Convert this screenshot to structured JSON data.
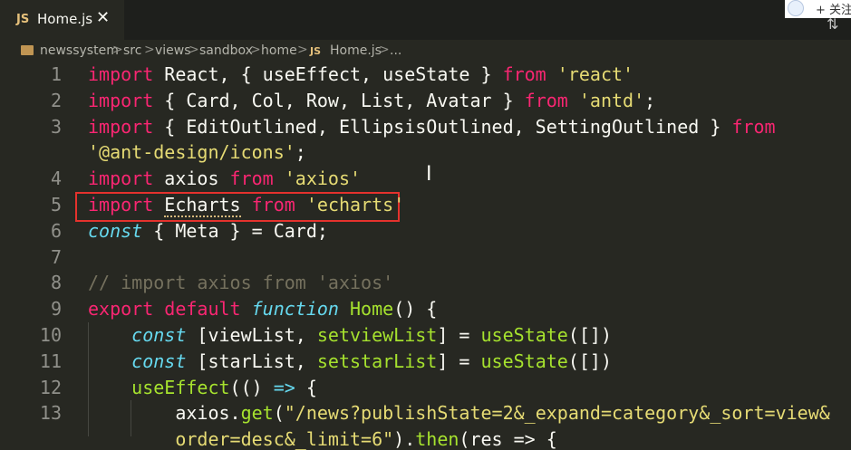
{
  "tab": {
    "badge": "JS",
    "filename": "Home.js",
    "close": "✕"
  },
  "account": {
    "follow_label": "+ 关注"
  },
  "toolbar": {
    "icon": "⇅"
  },
  "breadcrumb": {
    "parts": [
      "newssystem",
      "src",
      "views",
      "sandbox",
      "home"
    ],
    "file_badge": "JS",
    "file": "Home.js",
    "ellipsis": "...",
    "separator": ">"
  },
  "code": {
    "line_numbers": [
      "1",
      "2",
      "3",
      "",
      "4",
      "5",
      "6",
      "7",
      "8",
      "9",
      "10",
      "11",
      "12",
      "13"
    ],
    "lines": [
      [
        {
          "t": "import",
          "c": "kw"
        },
        {
          "t": " React, { useEffect, useState } ",
          "c": ""
        },
        {
          "t": "from",
          "c": "kw"
        },
        {
          "t": " ",
          "c": ""
        },
        {
          "t": "'react'",
          "c": "str"
        }
      ],
      [
        {
          "t": "import",
          "c": "kw"
        },
        {
          "t": " { Card, Col, Row, List, Avatar } ",
          "c": ""
        },
        {
          "t": "from",
          "c": "kw"
        },
        {
          "t": " ",
          "c": ""
        },
        {
          "t": "'antd'",
          "c": "str"
        },
        {
          "t": ";",
          "c": ""
        }
      ],
      [
        {
          "t": "import",
          "c": "kw"
        },
        {
          "t": " { EditOutlined, EllipsisOutlined, SettingOutlined } ",
          "c": ""
        },
        {
          "t": "from",
          "c": "kw"
        }
      ],
      [
        {
          "t": "'@ant-design/icons'",
          "c": "str"
        },
        {
          "t": ";",
          "c": ""
        }
      ],
      [
        {
          "t": "import",
          "c": "kw"
        },
        {
          "t": " axios ",
          "c": ""
        },
        {
          "t": "from",
          "c": "kw"
        },
        {
          "t": " ",
          "c": ""
        },
        {
          "t": "'axios'",
          "c": "str"
        }
      ],
      [
        {
          "t": "import",
          "c": "kw"
        },
        {
          "t": " ",
          "c": ""
        },
        {
          "t": "Echarts",
          "c": "squiggle"
        },
        {
          "t": " ",
          "c": ""
        },
        {
          "t": "from",
          "c": "kw"
        },
        {
          "t": " ",
          "c": ""
        },
        {
          "t": "'echarts'",
          "c": "str"
        }
      ],
      [
        {
          "t": "const",
          "c": "ital"
        },
        {
          "t": " { Meta } = Card;",
          "c": ""
        }
      ],
      [],
      [
        {
          "t": "// import axios from 'axios'",
          "c": "cmt"
        }
      ],
      [
        {
          "t": "export",
          "c": "kw"
        },
        {
          "t": " ",
          "c": ""
        },
        {
          "t": "default",
          "c": "kw"
        },
        {
          "t": " ",
          "c": ""
        },
        {
          "t": "function",
          "c": "ital"
        },
        {
          "t": " ",
          "c": ""
        },
        {
          "t": "Home",
          "c": "fn"
        },
        {
          "t": "() {",
          "c": ""
        }
      ],
      [
        {
          "t": "    ",
          "c": ""
        },
        {
          "t": "const",
          "c": "ital"
        },
        {
          "t": " [viewList, ",
          "c": ""
        },
        {
          "t": "setviewList",
          "c": "fn"
        },
        {
          "t": "] = ",
          "c": ""
        },
        {
          "t": "useState",
          "c": "fn"
        },
        {
          "t": "([])",
          "c": ""
        }
      ],
      [
        {
          "t": "    ",
          "c": ""
        },
        {
          "t": "const",
          "c": "ital"
        },
        {
          "t": " [starList, ",
          "c": ""
        },
        {
          "t": "setstarList",
          "c": "fn"
        },
        {
          "t": "] = ",
          "c": ""
        },
        {
          "t": "useState",
          "c": "fn"
        },
        {
          "t": "([])",
          "c": ""
        }
      ],
      [
        {
          "t": "    ",
          "c": ""
        },
        {
          "t": "useEffect",
          "c": "fn"
        },
        {
          "t": "(() ",
          "c": ""
        },
        {
          "t": "=>",
          "c": "ital"
        },
        {
          "t": " {",
          "c": ""
        }
      ],
      [
        {
          "t": "        axios.",
          "c": ""
        },
        {
          "t": "get",
          "c": "fn"
        },
        {
          "t": "(",
          "c": ""
        },
        {
          "t": "\"/news?publishState=2&_expand=category&_sort=view&",
          "c": "str"
        }
      ],
      [
        {
          "t": "        ",
          "c": ""
        },
        {
          "t": "order=desc&_limit=6\"",
          "c": "str"
        },
        {
          "t": ").",
          "c": ""
        },
        {
          "t": "then",
          "c": "fn"
        },
        {
          "t": "(res => {",
          "c": ""
        }
      ]
    ]
  }
}
